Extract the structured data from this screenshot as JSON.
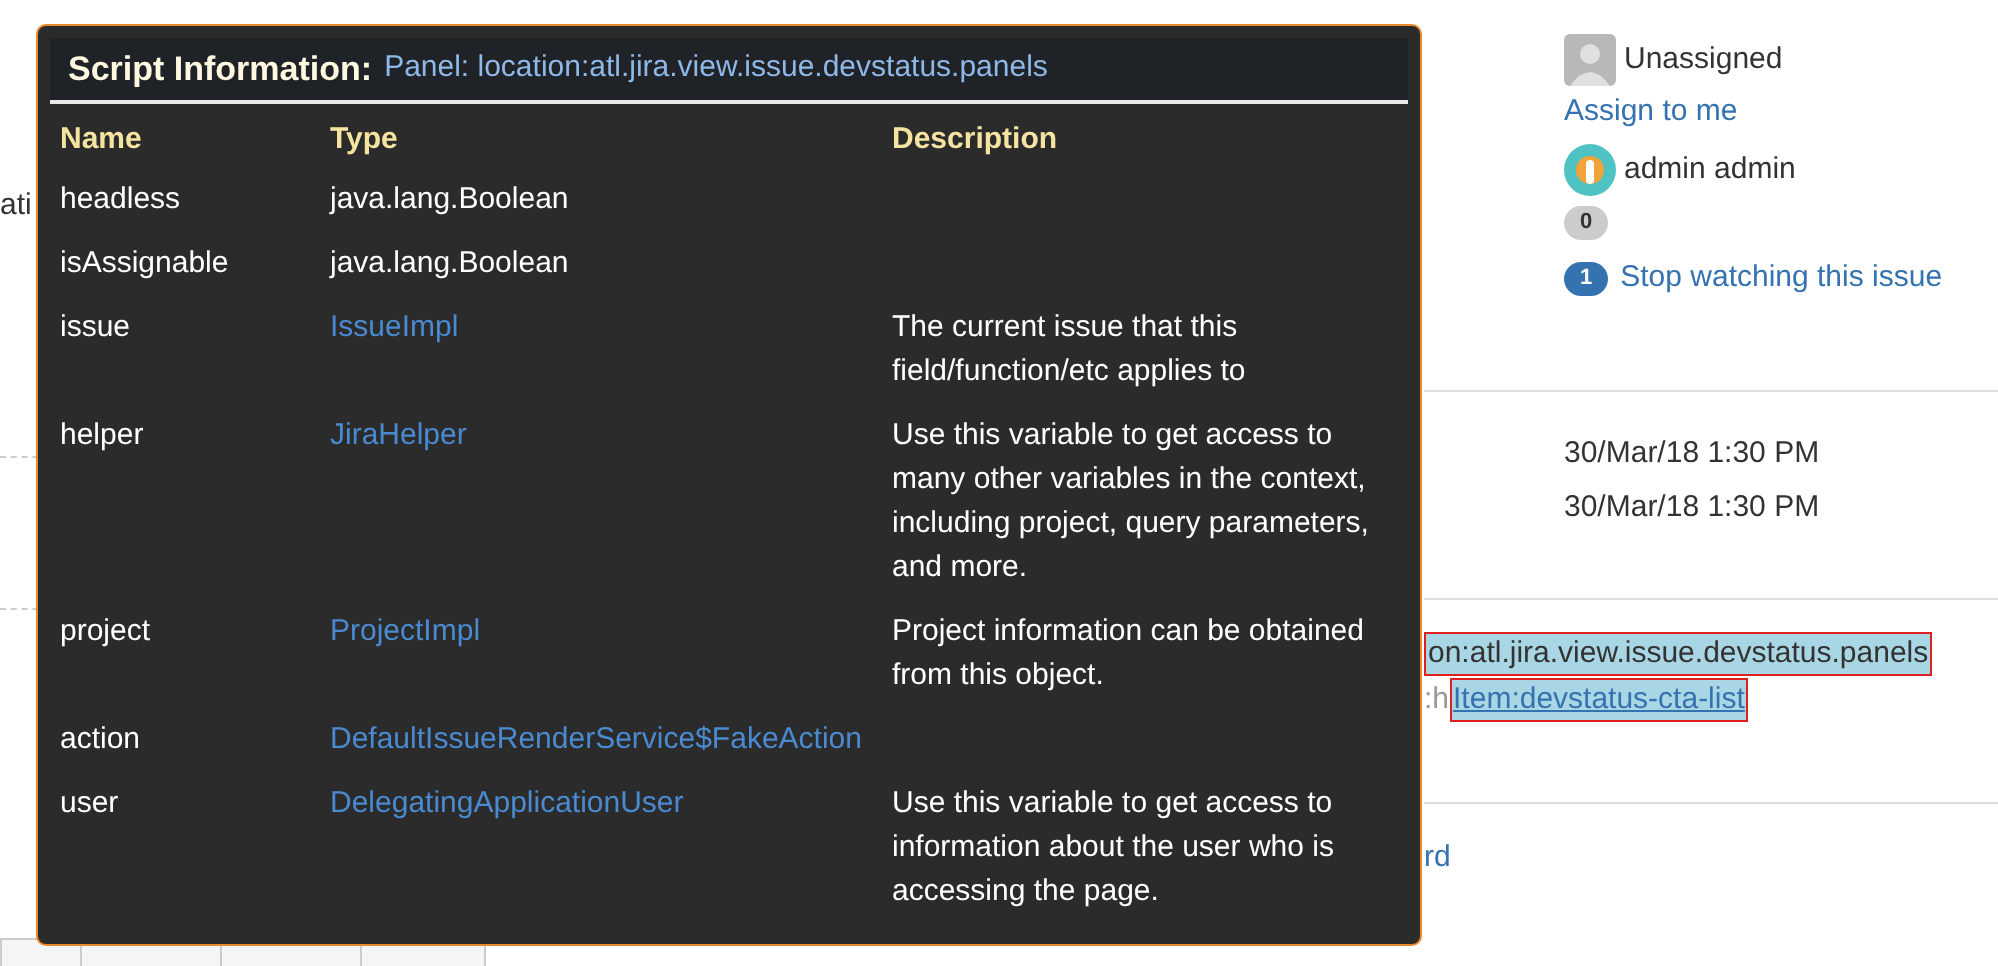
{
  "page": {
    "cut_label": "ati",
    "assignee": "Unassigned",
    "assign_link": "Assign to me",
    "reporter": "admin admin",
    "votes": "0",
    "watchers": "1",
    "watch_link": "Stop watching this issue",
    "dates": [
      "30/Mar/18 1:30 PM",
      "30/Mar/18 1:30 PM"
    ],
    "highlights": [
      {
        "kind": "text",
        "text": "on:atl.jira.view.issue.devstatus.panels"
      },
      {
        "kind": "link",
        "prefix": ":h",
        "text": "Item:devstatus-cta-list"
      }
    ],
    "link_fragment": "rd"
  },
  "popup": {
    "title": "Script Information:",
    "subtitle": "Panel: location:atl.jira.view.issue.devstatus.panels",
    "columns": [
      "Name",
      "Type",
      "Description"
    ],
    "rows": [
      {
        "name": "headless",
        "type": "java.lang.Boolean",
        "kind": "plain"
      },
      {
        "name": "isAssignable",
        "type": "java.lang.Boolean",
        "kind": "plain"
      },
      {
        "name": "issue",
        "type": "IssueImpl",
        "kind": "link",
        "description": "The current issue that this field/function/etc applies to"
      },
      {
        "name": "helper",
        "type": "JiraHelper",
        "kind": "link",
        "description": "Use this variable to get access to many other variables in the context, including project, query parameters, and more."
      },
      {
        "name": "project",
        "type": "ProjectImpl",
        "kind": "link",
        "description": "Project information can be obtained from this object."
      },
      {
        "name": "action",
        "type": "DefaultIssueRenderService$FakeAction",
        "kind": "link"
      },
      {
        "name": "user",
        "type": "DelegatingApplicationUser",
        "kind": "link",
        "description": "Use this variable to get access to information about the user who is accessing the page."
      }
    ]
  }
}
